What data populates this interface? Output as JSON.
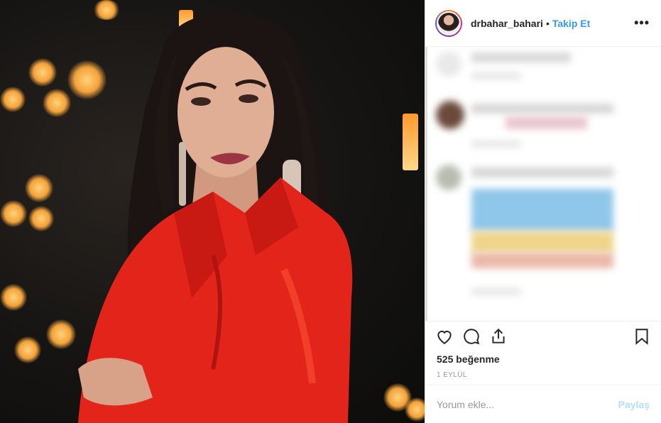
{
  "post": {
    "username": "drbahar_bahari",
    "dot": "•",
    "follow_label": "Takip Et",
    "more_icon": "more-options-icon",
    "likes_text": "525 beğenme",
    "date_text": "1 EYLÜL"
  },
  "comment_box": {
    "placeholder": "Yorum ekle...",
    "share_label": "Paylaş"
  },
  "icons": {
    "like": "heart-icon",
    "comment": "comment-icon",
    "share": "share-icon",
    "save": "bookmark-icon"
  },
  "colors": {
    "accent": "#3897f0",
    "share_disabled": "#b2dffc",
    "dress": "#e3241a"
  }
}
